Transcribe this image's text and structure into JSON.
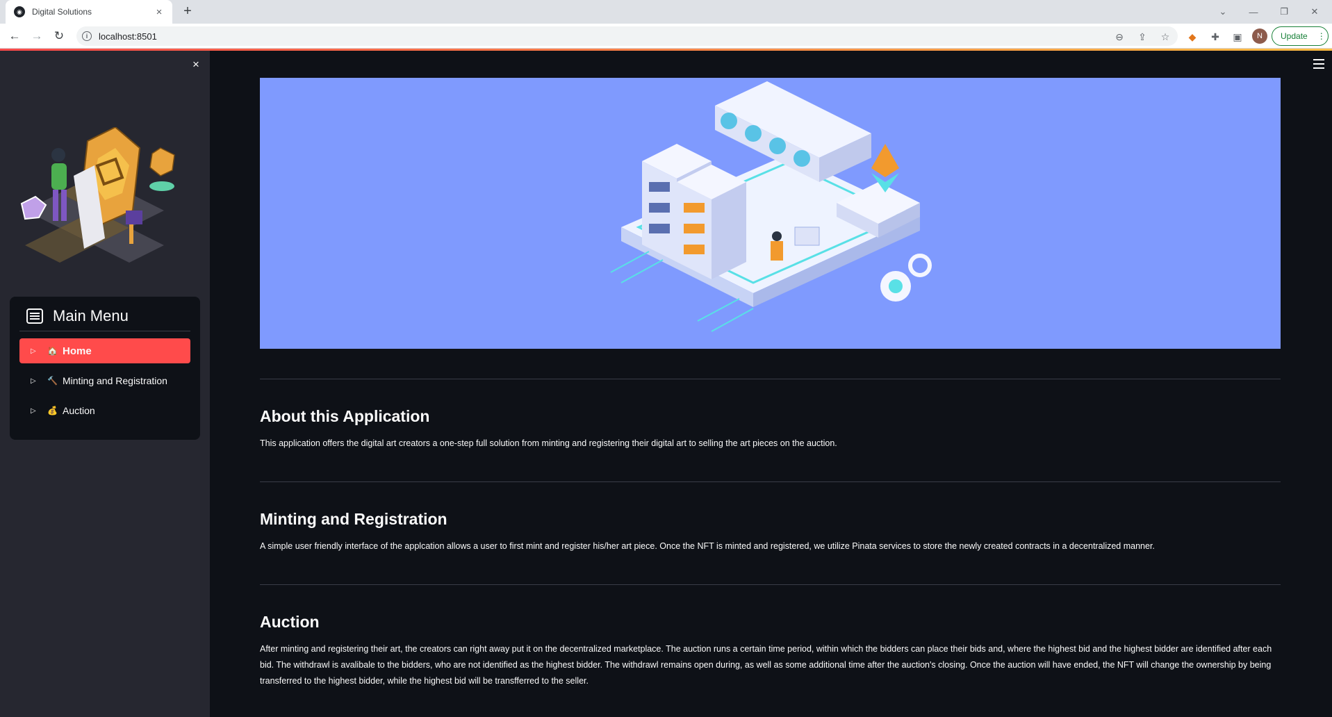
{
  "browser": {
    "tab_title": "Digital Solutions",
    "tab_close": "×",
    "new_tab": "+",
    "url": "localhost:8501",
    "profile_initial": "N",
    "update_label": "Update"
  },
  "sidebar": {
    "close_glyph": "×",
    "menu_title": "Main Menu",
    "items": [
      {
        "emoji": "🏠",
        "label": "Home",
        "active": true
      },
      {
        "emoji": "🔨",
        "label": "Minting and Registration",
        "active": false
      },
      {
        "emoji": "💰",
        "label": "Auction",
        "active": false
      }
    ]
  },
  "main": {
    "sections": [
      {
        "title": "About this Application",
        "body": "This application offers the digital art creators a one-step full solution from minting and registering their digital art to selling the art pieces on the auction."
      },
      {
        "title": "Minting and Registration",
        "body": "A simple user friendly interface of the applcation allows a user to first mint and register his/her art piece. Once the NFT is minted and registered, we utilize Pinata services to store the newly created contracts in a decentralized manner."
      },
      {
        "title": "Auction",
        "body": "After minting and registering their art, the creators can right away put it on the decentralized marketplace. The auction runs a certain time period, within which the bidders can place their bids and, where the highest bid and the highest bidder are identified after each bid. The withdrawl is avalibale to the bidders, who are not identified as the highest bidder. The withdrawl remains open during, as well as some additional time after the auction's closing. Once the auction will have ended, the NFT will change the ownership by being transferred to the highest bidder, while the highest bid will be transfferred to the seller."
      }
    ]
  },
  "colors": {
    "accent": "#ff4b4b",
    "hero_bg": "#7f9afe",
    "app_bg": "#0e1117",
    "sidebar_bg": "#262730"
  }
}
